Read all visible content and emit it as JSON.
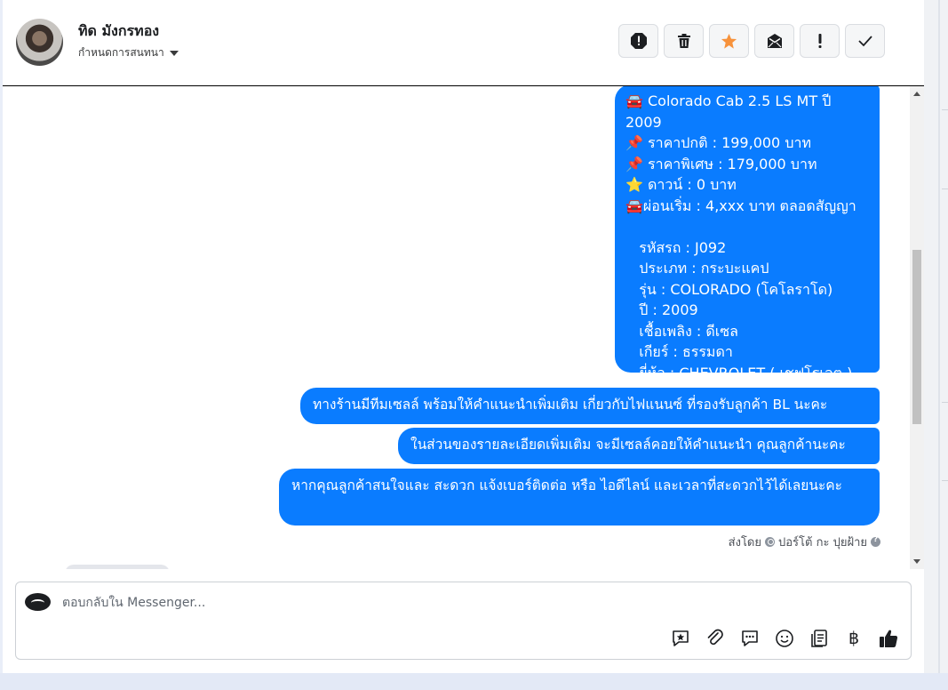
{
  "contact": {
    "name": "ทิด มังกรทอง",
    "assign_label": "กำหนดการสนทนา"
  },
  "actions": [
    {
      "name": "report-icon",
      "color": "#1c1e21"
    },
    {
      "name": "trash-icon",
      "color": "#1c1e21"
    },
    {
      "name": "star-icon",
      "color": "#f7923b"
    },
    {
      "name": "mark-unread-icon",
      "color": "#1c1e21"
    },
    {
      "name": "exclamation-icon",
      "color": "#1c1e21"
    },
    {
      "name": "check-icon",
      "color": "#1c1e21"
    }
  ],
  "messages": {
    "m1": "🚘 Colorado Cab 2.5 LS MT ปี 2009\n📌 ราคาปกติ : 199,000 บาท\n📌 ราคาพิเศษ : 179,000 บาท\n⭐ ดาวน์ : 0 บาท\n🚘ผ่อนเริ่ม : 4,xxx บาท ตลอดสัญญา\n\n   รหัสรถ : J092\n   ประเภท : กระบะแคป\n   รุ่น : COLORADO (โคโลราโด)\n   ปี : 2009\n   เชื้อเพลิง : ดีเซล\n   เกียร์ : ธรรมดา\n   ยี่ห้อ : CHEVROLET ( เชฟโรเลต )",
    "m2": "ทางร้านมีทีมเซลล์ พร้อมให้คำแนะนำเพิ่มเติม เกี่ยวกับไฟแนนซ์ ที่รองรับลูกค้า BL นะคะ",
    "m3": "ในส่วนของรายละเอียดเพิ่มเติม จะมีเซลล์คอยให้คำแนะนำ คุณลูกค้านะคะ",
    "m4": "หากคุณลูกค้าสนใจและ สะดวก แจ้งเบอร์ติดต่อ หรือ ไอดีไลน์ และเวลาที่สะดวกไว้ได้เลยนะคะ"
  },
  "sent_by": {
    "prefix": "ส่งโดย",
    "name": "ปอร์โต้ กะ ปุยฝ้าย"
  },
  "composer": {
    "placeholder": "ตอบกลับใน Messenger...",
    "tools": [
      "saved-reply-icon",
      "attachment-icon",
      "chat-bubble-icon",
      "emoji-icon",
      "catalog-icon",
      "currency-icon",
      "thumbs-up-icon"
    ],
    "currency_symbol": "฿"
  },
  "colors": {
    "bubble": "#0a7cff",
    "accent_star": "#f7923b"
  }
}
